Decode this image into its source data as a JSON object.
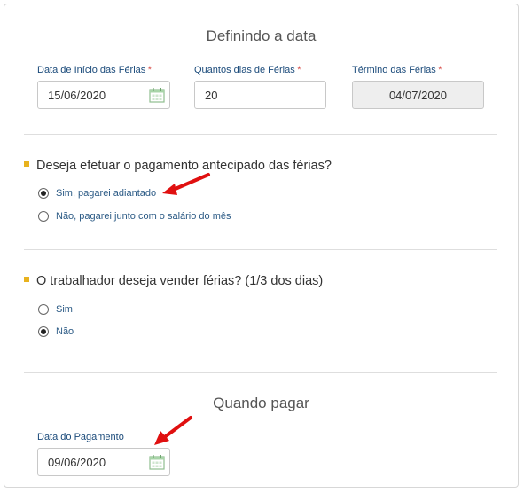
{
  "section1": {
    "title": "Definindo a data",
    "start": {
      "label": "Data de Início das Férias",
      "required": "*",
      "value": "15/06/2020"
    },
    "days": {
      "label": "Quantos dias de Férias",
      "required": "*",
      "value": "20"
    },
    "end": {
      "label": "Término das Férias",
      "required": "*",
      "value": "04/07/2020"
    }
  },
  "question1": {
    "text": "Deseja efetuar o pagamento antecipado das férias?",
    "options": [
      {
        "label": "Sim, pagarei adiantado",
        "selected": true
      },
      {
        "label": "Não, pagarei junto com o salário do mês",
        "selected": false
      }
    ]
  },
  "question2": {
    "text": "O trabalhador deseja vender férias? (1/3 dos dias)",
    "options": [
      {
        "label": "Sim",
        "selected": false
      },
      {
        "label": "Não",
        "selected": true
      }
    ]
  },
  "section2": {
    "title": "Quando pagar",
    "payment": {
      "label": "Data do Pagamento",
      "value": "09/06/2020"
    }
  },
  "colors": {
    "accent_bullet": "#e8b21e",
    "label_blue": "#1a4a7a",
    "required_red": "#d9534f",
    "annotation_arrow": "#e01010"
  },
  "icons": [
    "calendar-icon",
    "annotation-arrow"
  ]
}
